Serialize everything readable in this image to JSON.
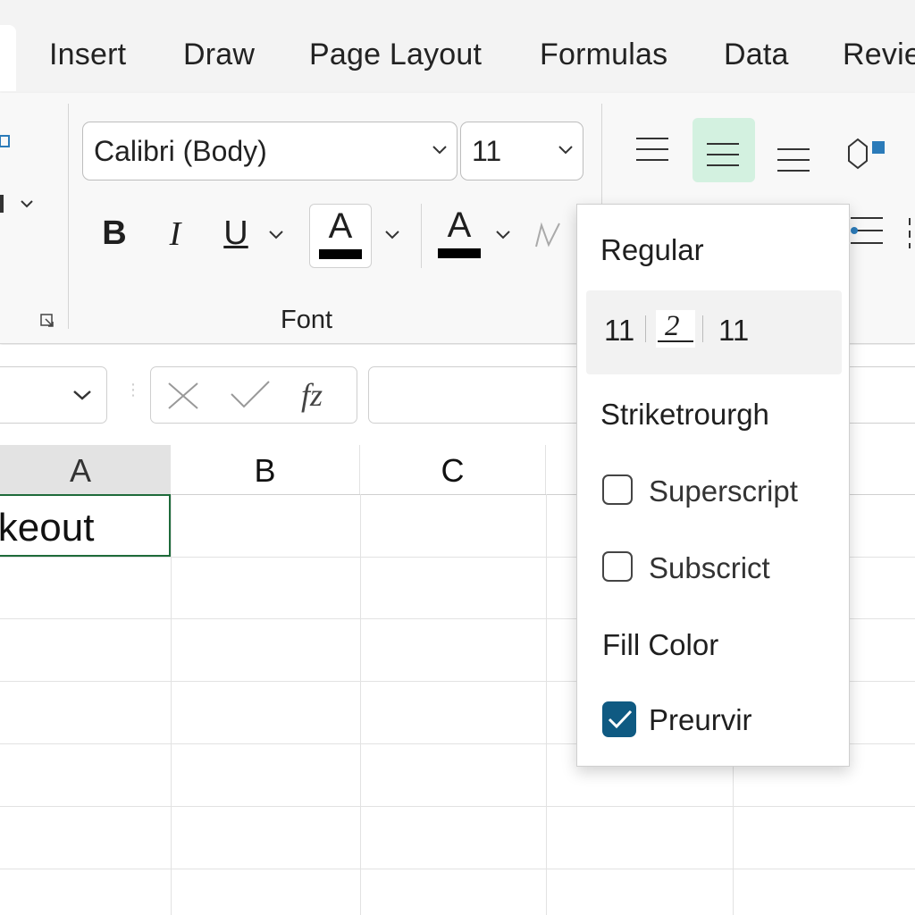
{
  "tabs": [
    "Insert",
    "Draw",
    "Page Layout",
    "Formulas",
    "Data",
    "Revie"
  ],
  "font": {
    "name": "Calibri (Body)",
    "size": "11",
    "bold_label": "B",
    "italic_label": "I",
    "underline_label": "U",
    "font_color_glyph": "A",
    "highlight_glyph": "A",
    "group_label": "Font"
  },
  "formula_bar": {
    "fx_label": "fz"
  },
  "columns": [
    "A",
    "B",
    "C"
  ],
  "cell_a1": "ikeout",
  "dropdown": {
    "style_label": "Regular",
    "size_left": "11",
    "size_mid": "2",
    "size_right": "11",
    "strikethrough_label": "Striketrourgh",
    "superscript_label": "Superscript",
    "subscript_label": "Subscrict",
    "fill_color_label": "Fill Color",
    "preview_label": "Preurvir",
    "superscript_checked": false,
    "subscript_checked": false,
    "preview_checked": true
  },
  "colors": {
    "accent": "#0f5a82",
    "selected_align_bg": "#d3f1e0",
    "active_cell_border": "#1e6b3a"
  }
}
